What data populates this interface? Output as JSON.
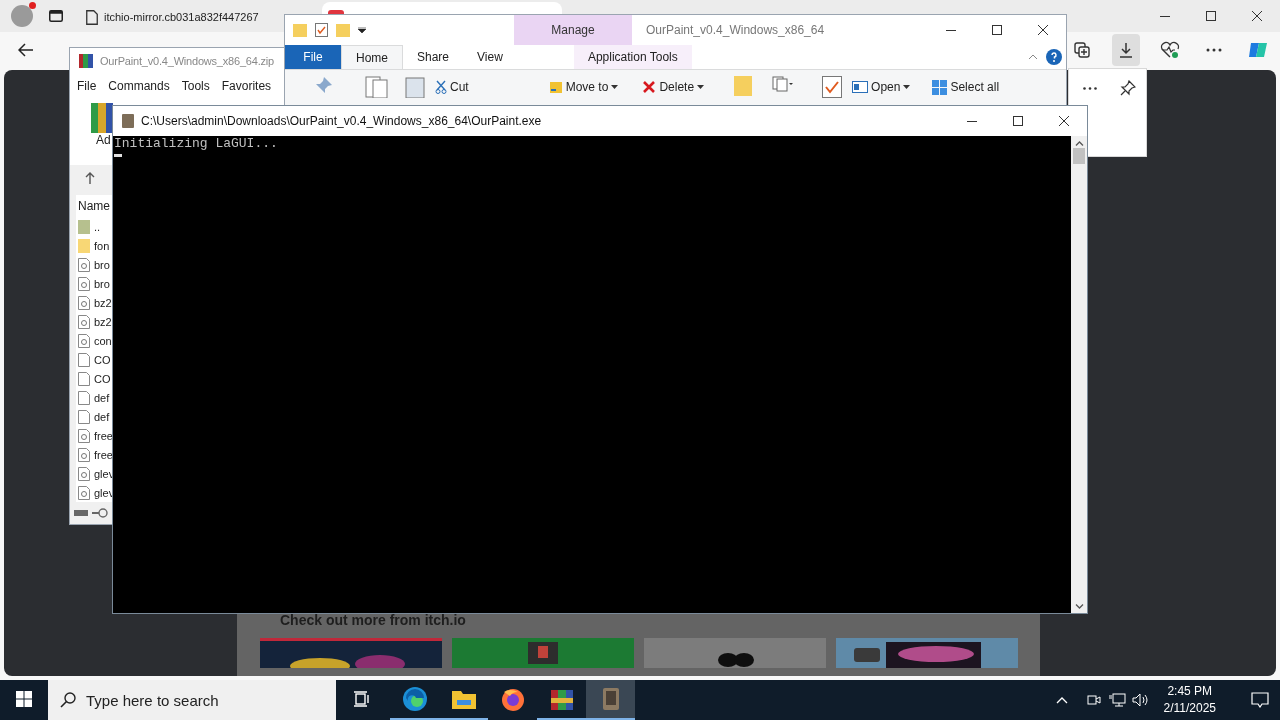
{
  "browser": {
    "tabs": [
      {
        "title": "itchio-mirror.cb031a832f447267",
        "selected": false
      },
      {
        "selected": true
      }
    ],
    "toolbar": [
      {
        "kind": "collections",
        "selected": false
      },
      {
        "kind": "downloads",
        "selected": true
      },
      {
        "kind": "health",
        "selected": false
      },
      {
        "kind": "more",
        "selected": false
      },
      {
        "kind": "copilot",
        "selected": false
      }
    ],
    "page": {
      "heading": "Check out more from itch.io"
    }
  },
  "winrar": {
    "title": "OurPaint_v0.4_Windows_x86_64.zip",
    "menu": [
      "File",
      "Commands",
      "Tools",
      "Favorites"
    ],
    "toolbar_label": "Ad",
    "column": "Name",
    "files": [
      {
        "name": "..",
        "kind": "parent"
      },
      {
        "name": "fon",
        "kind": "folder"
      },
      {
        "name": "bro",
        "kind": "dll"
      },
      {
        "name": "bro",
        "kind": "dll"
      },
      {
        "name": "bz2",
        "kind": "dll"
      },
      {
        "name": "bz2",
        "kind": "dll"
      },
      {
        "name": "con",
        "kind": "dll"
      },
      {
        "name": "CO",
        "kind": "file"
      },
      {
        "name": "CO",
        "kind": "file"
      },
      {
        "name": "def",
        "kind": "file"
      },
      {
        "name": "def",
        "kind": "file"
      },
      {
        "name": "free",
        "kind": "dll"
      },
      {
        "name": "free",
        "kind": "dll"
      },
      {
        "name": "glev",
        "kind": "dll"
      },
      {
        "name": "glev",
        "kind": "dll"
      }
    ]
  },
  "explorer": {
    "title": "OurPaint_v0.4_Windows_x86_64",
    "context_tab": "Manage",
    "tabs": [
      {
        "label": "File",
        "kind": "file",
        "selected": false
      },
      {
        "label": "Home",
        "kind": "tab",
        "selected": true
      },
      {
        "label": "Share",
        "kind": "tab",
        "selected": false
      },
      {
        "label": "View",
        "kind": "tab",
        "selected": false
      },
      {
        "label": "Application Tools",
        "kind": "context",
        "selected": false
      }
    ],
    "ribbon": [
      {
        "label": "Cut",
        "kind": "cut"
      },
      {
        "label": "Move to",
        "kind": "move"
      },
      {
        "label": "Delete",
        "kind": "delete"
      },
      {
        "label": "Open",
        "kind": "open"
      },
      {
        "label": "Select all",
        "kind": "select"
      }
    ]
  },
  "console": {
    "title": "C:\\Users\\admin\\Downloads\\OurPaint_v0.4_Windows_x86_64\\OurPaint.exe",
    "lines": [
      "Initializing LaGUI..."
    ]
  },
  "taskbar": {
    "search_placeholder": "Type here to search",
    "apps": [
      {
        "kind": "edge",
        "running": true,
        "selected": false
      },
      {
        "kind": "explorer",
        "running": true,
        "selected": false
      },
      {
        "kind": "firefox",
        "running": false,
        "selected": false
      },
      {
        "kind": "winrar",
        "running": true,
        "selected": false
      },
      {
        "kind": "ourpaint",
        "running": true,
        "selected": true
      }
    ],
    "time": "2:45 PM",
    "date": "2/11/2025"
  }
}
